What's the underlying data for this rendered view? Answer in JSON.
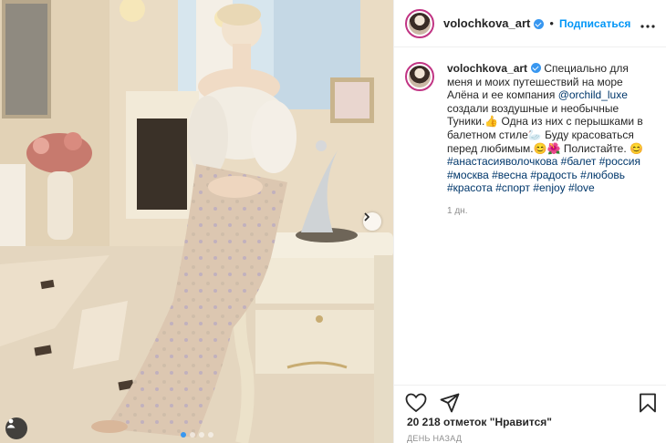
{
  "post": {
    "username": "volochkova_art",
    "follow_label": "Подписаться",
    "separator": "•",
    "caption_text_1": "Специально для меня и моих путешествий на море Алёна и ее компания",
    "mention": "@orchild_luxe",
    "caption_text_2": "создали воздушные и необычные Туники.👍 Одна из них с перышками в балетном стиле🦢 Буду красоваться перед любимым.😊🌺 Полистайте. 😊",
    "hashtags": [
      "#анастасияволочкова",
      "#балет",
      "#россия",
      "#москва",
      "#весна",
      "#радость",
      "#любовь",
      "#красота",
      "#спорт",
      "#enjoy",
      "#love"
    ],
    "time_ago": "1 дн.",
    "likes_count": "20 218 отметок",
    "likes_word": "\"Нравится\"",
    "date_label": "ДЕНЬ НАЗАД"
  },
  "icons": {
    "more": "more-options-icon",
    "heart": "heart-icon",
    "share": "share-icon",
    "save": "bookmark-icon",
    "tag": "user-tag-icon",
    "next": "chevron-right-icon"
  },
  "carousel": {
    "total": 4,
    "active": 1
  },
  "colors": {
    "accent": "#0095f6",
    "tag_link": "#00376b",
    "muted": "#8e8e8e",
    "active_dot": "#3897f0"
  }
}
